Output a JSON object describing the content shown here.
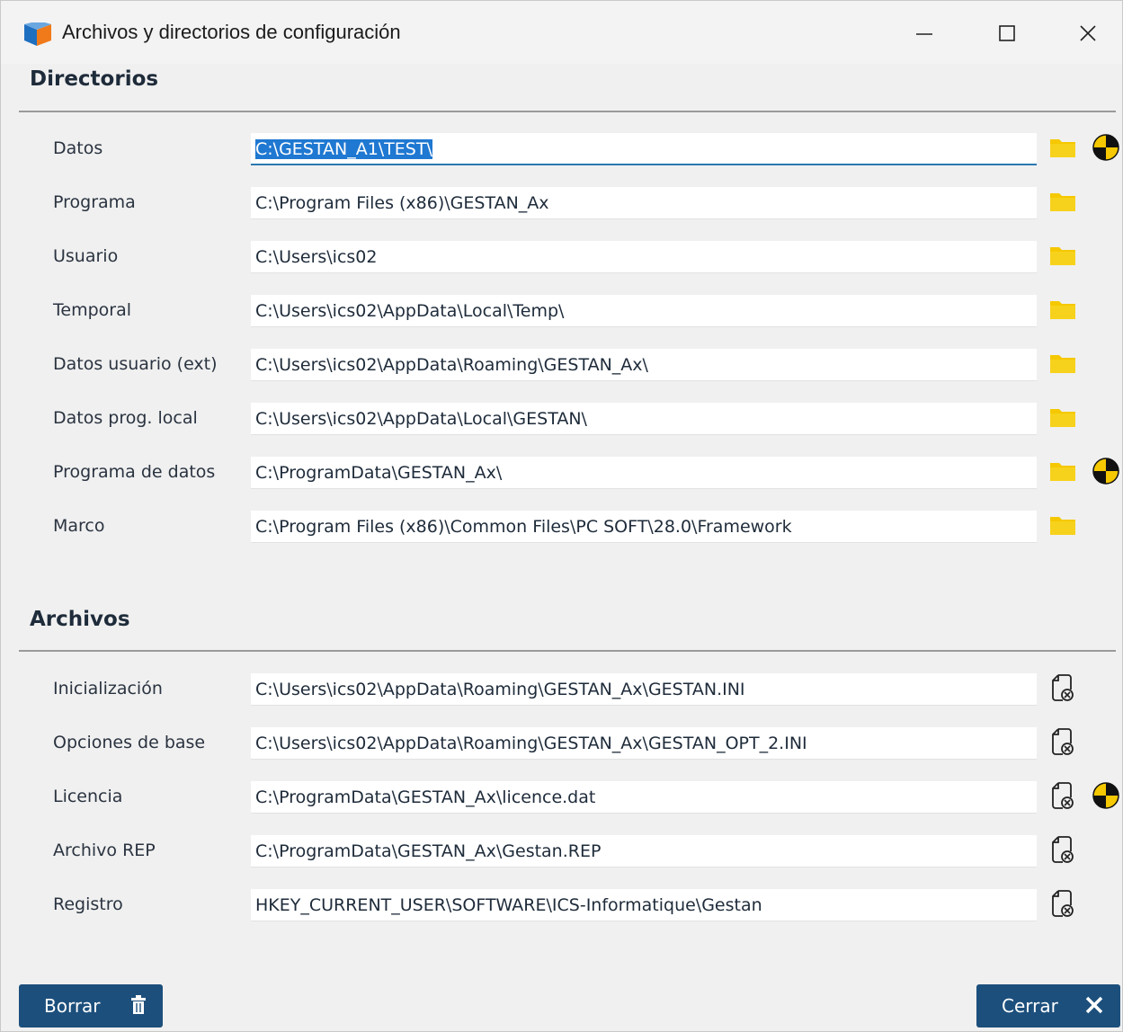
{
  "window": {
    "title": "Archivos y directorios de configuración"
  },
  "sections": {
    "directorios": "Directorios",
    "archivos": "Archivos"
  },
  "directorios": [
    {
      "label": "Datos",
      "value": "C:\\GESTAN_A1\\TEST\\",
      "selected": true,
      "open_icon": "folder-icon",
      "extra_icon": "target-icon"
    },
    {
      "label": "Programa",
      "value": "C:\\Program Files (x86)\\GESTAN_Ax",
      "open_icon": "folder-icon"
    },
    {
      "label": "Usuario",
      "value": "C:\\Users\\ics02",
      "open_icon": "folder-icon"
    },
    {
      "label": "Temporal",
      "value": "C:\\Users\\ics02\\AppData\\Local\\Temp\\",
      "open_icon": "folder-icon"
    },
    {
      "label": "Datos usuario (ext)",
      "value": "C:\\Users\\ics02\\AppData\\Roaming\\GESTAN_Ax\\",
      "open_icon": "folder-icon"
    },
    {
      "label": "Datos prog. local",
      "value": "C:\\Users\\ics02\\AppData\\Local\\GESTAN\\",
      "open_icon": "folder-icon"
    },
    {
      "label": "Programa de datos",
      "value": "C:\\ProgramData\\GESTAN_Ax\\",
      "open_icon": "folder-icon",
      "extra_icon": "target-icon"
    },
    {
      "label": "Marco",
      "value": "C:\\Program Files (x86)\\Common Files\\PC SOFT\\28.0\\Framework",
      "open_icon": "folder-icon"
    }
  ],
  "archivos": [
    {
      "label": "Inicialización",
      "value": "C:\\Users\\ics02\\AppData\\Roaming\\GESTAN_Ax\\GESTAN.INI",
      "open_icon": "file-settings-icon"
    },
    {
      "label": "Opciones de base",
      "value": "C:\\Users\\ics02\\AppData\\Roaming\\GESTAN_Ax\\GESTAN_OPT_2.INI",
      "open_icon": "file-settings-icon"
    },
    {
      "label": "Licencia",
      "value": "C:\\ProgramData\\GESTAN_Ax\\licence.dat",
      "open_icon": "file-settings-icon",
      "extra_icon": "target-icon"
    },
    {
      "label": "Archivo REP",
      "value": "C:\\ProgramData\\GESTAN_Ax\\Gestan.REP",
      "open_icon": "file-settings-icon"
    },
    {
      "label": "Registro",
      "value": "HKEY_CURRENT_USER\\SOFTWARE\\ICS-Informatique\\Gestan",
      "open_icon": "file-settings-icon"
    }
  ],
  "buttons": {
    "borrar": "Borrar",
    "cerrar": "Cerrar"
  },
  "colors": {
    "accent": "#1c4f7c",
    "folder": "#f5c800",
    "selection": "#1f78d1"
  }
}
